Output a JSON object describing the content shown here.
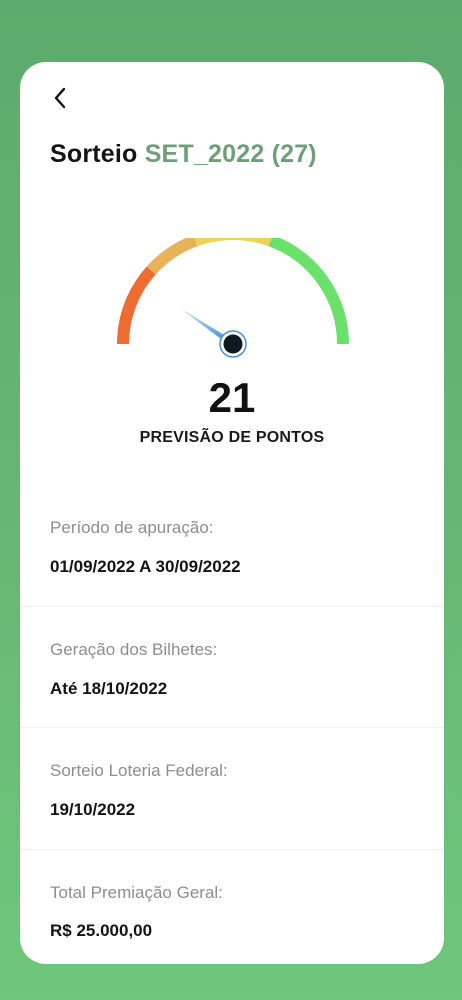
{
  "header": {
    "title_prefix": "Sorteio",
    "title_highlight": "SET_2022 (27)",
    "accent_color": "#6f9f78"
  },
  "gauge": {
    "value": 21,
    "label": "PREVISÃO DE PONTOS",
    "segment_colors": [
      "#ee6b32",
      "#e8b25a",
      "#eed35a",
      "#6be06a"
    ]
  },
  "info": [
    {
      "label": "Período de apuração:",
      "value": "01/09/2022 A 30/09/2022"
    },
    {
      "label": "Geração dos Bilhetes:",
      "value": "Até 18/10/2022"
    },
    {
      "label": "Sorteio Loteria Federal:",
      "value": "19/10/2022"
    },
    {
      "label": "Total Premiação Geral:",
      "value": "R$ 25.000,00"
    }
  ]
}
